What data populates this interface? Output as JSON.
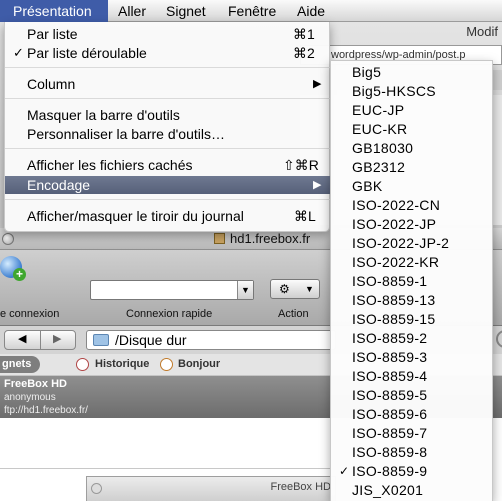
{
  "menubar": {
    "items": [
      "Présentation",
      "Aller",
      "Signet",
      "Fenêtre",
      "Aide"
    ]
  },
  "browser_window": {
    "title_partial": "Modif",
    "url_partial": "wordpress/wp-admin/post.p"
  },
  "presentation_menu": {
    "par_liste": "Par liste",
    "par_liste_shortcut": "⌘1",
    "par_liste_deroulable": "Par liste déroulable",
    "par_liste_deroulable_shortcut": "⌘2",
    "check_mark": "✓",
    "column": "Column",
    "masquer_barre": "Masquer la barre d'outils",
    "personnaliser_barre": "Personnaliser la barre d'outils…",
    "afficher_caches": "Afficher les fichiers cachés",
    "afficher_caches_shortcut": "⇧⌘R",
    "encodage": "Encodage",
    "afficher_tiroir": "Afficher/masquer le tiroir du journal",
    "afficher_tiroir_shortcut": "⌘L",
    "submenu_arrow": "▶"
  },
  "encoding_submenu": {
    "items": [
      "Big5",
      "Big5-HKSCS",
      "EUC-JP",
      "EUC-KR",
      "GB18030",
      "GB2312",
      "GBK",
      "ISO-2022-CN",
      "ISO-2022-JP",
      "ISO-2022-JP-2",
      "ISO-2022-KR",
      "ISO-8859-1",
      "ISO-8859-13",
      "ISO-8859-15",
      "ISO-8859-2",
      "ISO-8859-3",
      "ISO-8859-4",
      "ISO-8859-5",
      "ISO-8859-6",
      "ISO-8859-7",
      "ISO-8859-8",
      "ISO-8859-9",
      "JIS_X0201"
    ],
    "checked": "ISO-8859-9"
  },
  "ftp_window": {
    "title": "hd1.freebox.fr",
    "toolbar": {
      "connexion_label": "e connexion",
      "connexion_rapide_label": "Connexion rapide",
      "action_label": "Action",
      "action_glyph": "⚙",
      "dropdown_glyph": "▼"
    },
    "nav": {
      "back": "◀",
      "forward": "▶",
      "path": "/Disque dur"
    },
    "tabs": {
      "signets": "gnets",
      "historique": "Historique",
      "bonjour": "Bonjour"
    },
    "bookmark": {
      "name": "FreeBox HD",
      "user": "anonymous",
      "url": "ftp://hd1.freebox.fr/"
    }
  },
  "small_window": {
    "title": "FreeBox HD"
  },
  "colors": {
    "menubar_active": "#3f5ca8",
    "menu_highlight": "#566079"
  }
}
